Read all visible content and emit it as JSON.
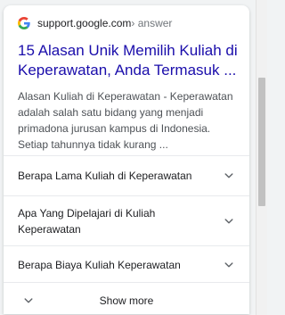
{
  "result": {
    "site": "support.google.com",
    "breadcrumb": " › answer",
    "title": "15 Alasan Unik Memilih Kuliah di Keperawatan, Anda Termasuk ...",
    "snippet": "Alasan Kuliah di Keperawatan - Keperawatan adalah salah satu bidang yang menjadi primadona jurusan kampus di Indonesia. Setiap tahunnya tidak kurang ..."
  },
  "questions": [
    {
      "label": "Berapa Lama Kuliah di Keperawatan"
    },
    {
      "label": "Apa Yang Dipelajari di Kuliah Keperawatan"
    },
    {
      "label": "Berapa Biaya Kuliah Keperawatan"
    }
  ],
  "show_more": "Show more",
  "icons": {
    "source_logo": "google-g-icon",
    "expand": "chevron-down-icon"
  },
  "colors": {
    "title_link": "#1a0dab",
    "snippet_text": "#4d5156",
    "divider": "#e8eaed"
  }
}
